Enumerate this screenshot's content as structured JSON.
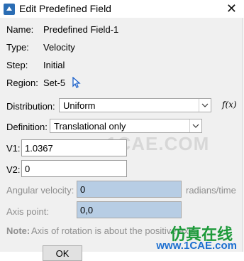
{
  "window": {
    "title": "Edit Predefined Field",
    "close_symbol": "✕"
  },
  "info": {
    "name_label": "Name:",
    "name_value": "Predefined Field-1",
    "type_label": "Type:",
    "type_value": "Velocity",
    "step_label": "Step:",
    "step_value": "Initial",
    "region_label": "Region:",
    "region_value": "Set-5"
  },
  "distribution": {
    "label": "Distribution:",
    "value": "Uniform",
    "fx_label": "f(x)"
  },
  "definition": {
    "label": "Definition:",
    "value": "Translational only"
  },
  "v1": {
    "label": "V1:",
    "value": "1.0367"
  },
  "v2": {
    "label": "V2:",
    "value": "0"
  },
  "angular": {
    "label": "Angular velocity:",
    "value": "0",
    "units": "radians/time"
  },
  "axis": {
    "label": "Axis point:",
    "value": "0,0"
  },
  "note": {
    "label": "Note:",
    "text": "Axis of rotation is about the positive axis"
  },
  "buttons": {
    "ok": "OK"
  },
  "watermark": {
    "text": "1CAE.COM",
    "brand_cn": "仿真在线",
    "brand_url": "www.1CAE.com"
  },
  "colors": {
    "field_blue": "#b7cde4",
    "brand_green": "#1d9a3a",
    "brand_blue": "#1d6fd0"
  }
}
